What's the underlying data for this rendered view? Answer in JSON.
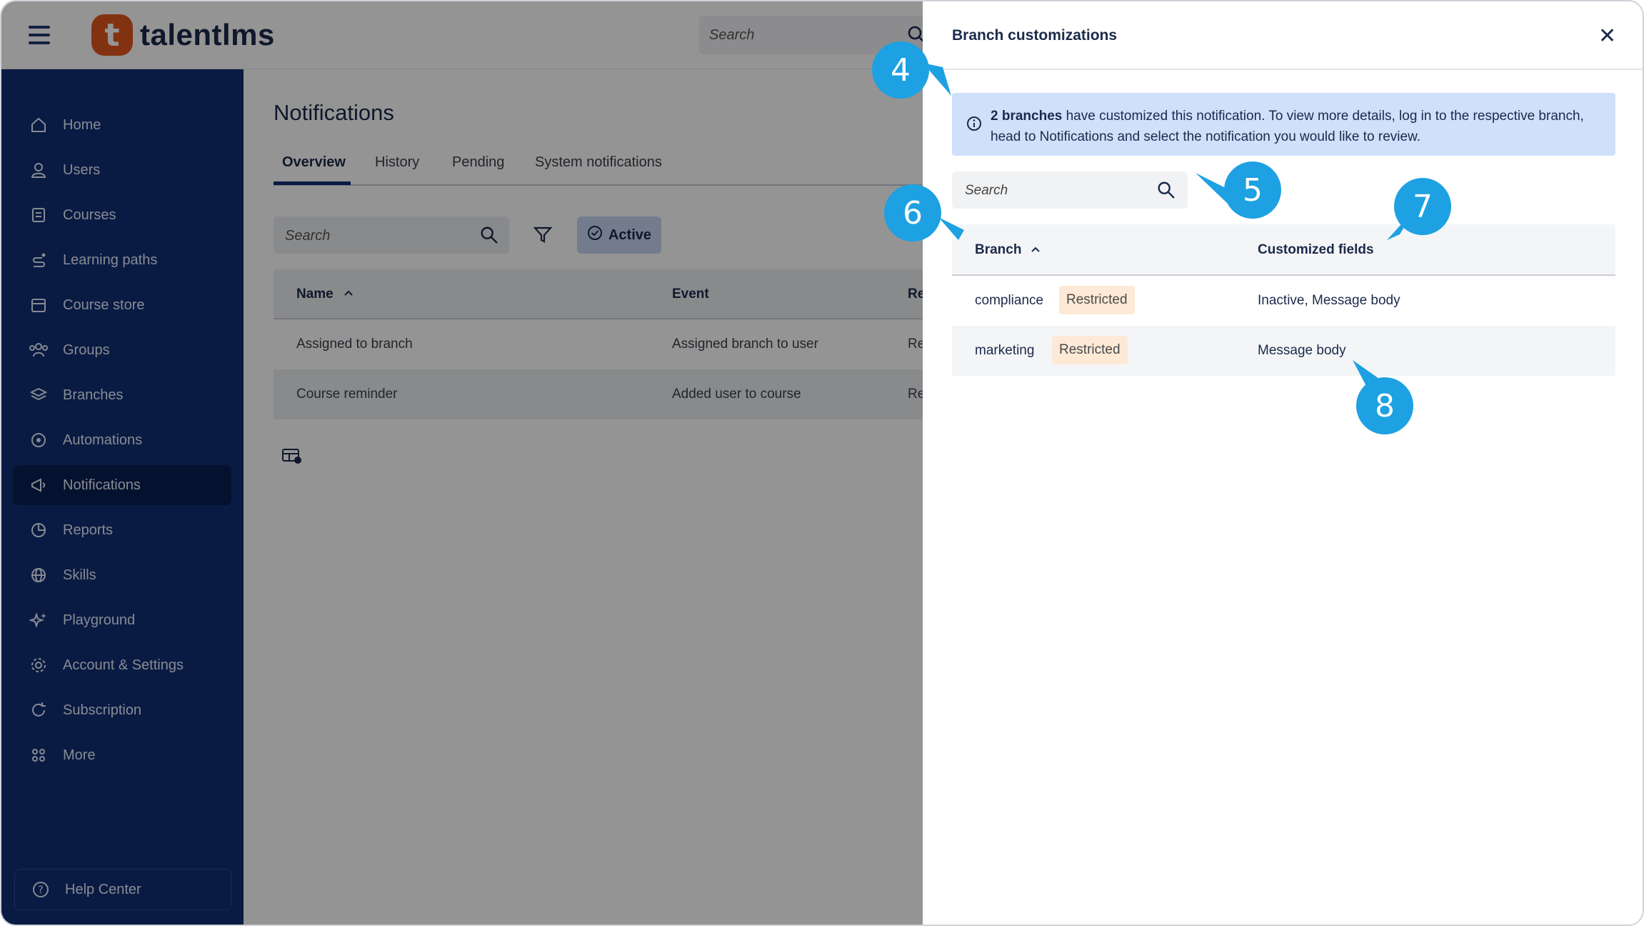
{
  "app": {
    "logo_letter": "t",
    "logo_text": "talentlms"
  },
  "topbar": {
    "search_placeholder": "Search"
  },
  "sidebar": {
    "items": [
      {
        "label": "Home",
        "icon": "home-icon"
      },
      {
        "label": "Users",
        "icon": "user-icon"
      },
      {
        "label": "Courses",
        "icon": "book-icon"
      },
      {
        "label": "Learning paths",
        "icon": "path-icon"
      },
      {
        "label": "Course store",
        "icon": "store-icon"
      },
      {
        "label": "Groups",
        "icon": "groups-icon"
      },
      {
        "label": "Branches",
        "icon": "layers-icon"
      },
      {
        "label": "Automations",
        "icon": "automation-icon"
      },
      {
        "label": "Notifications",
        "icon": "megaphone-icon",
        "active": true
      },
      {
        "label": "Reports",
        "icon": "pie-chart-icon"
      },
      {
        "label": "Skills",
        "icon": "globe-icon"
      },
      {
        "label": "Playground",
        "icon": "sparkle-icon"
      },
      {
        "label": "Account & Settings",
        "icon": "gear-icon"
      },
      {
        "label": "Subscription",
        "icon": "refresh-icon"
      },
      {
        "label": "More",
        "icon": "grid-icon"
      }
    ],
    "help_label": "Help Center"
  },
  "main": {
    "title": "Notifications",
    "tabs": [
      "Overview",
      "History",
      "Pending",
      "System notifications"
    ],
    "active_tab": "Overview",
    "search_placeholder": "Search",
    "active_filter_label": "Active",
    "columns": [
      "Name",
      "Event",
      "Re"
    ],
    "rows": [
      {
        "name": "Assigned to branch",
        "event": "Assigned branch to user",
        "rec": "Re"
      },
      {
        "name": "Course reminder",
        "event": "Added user to course",
        "rec": "Re"
      }
    ]
  },
  "drawer": {
    "title": "Branch customizations",
    "info_bold": "2 branches",
    "info_line1": " have customized this notification. To view more details, log in to the respective branch,",
    "info_line2": "head to Notifications and select the notification you would like to review.",
    "search_placeholder": "Search",
    "columns": [
      "Branch",
      "Customized fields"
    ],
    "rows": [
      {
        "branch": "compliance",
        "badge": "Restricted",
        "fields": "Inactive, Message body"
      },
      {
        "branch": "marketing",
        "badge": "Restricted",
        "fields": "Message body"
      }
    ]
  },
  "callouts": [
    "4",
    "5",
    "6",
    "7",
    "8"
  ],
  "colors": {
    "sidebar": "#102f74",
    "accent": "#1da1e2",
    "badge": "#fde9d6",
    "info": "#cfe0fb"
  }
}
